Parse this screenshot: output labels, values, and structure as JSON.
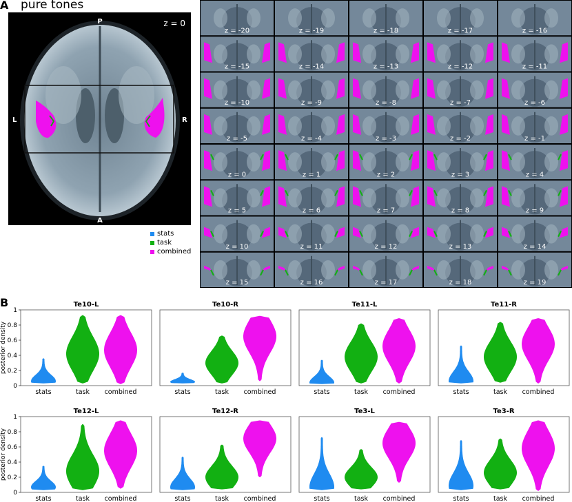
{
  "panelA": {
    "letter": "A",
    "title": "pure tones",
    "big_slice": {
      "label": "z = 0",
      "orientation": {
        "top": "P",
        "bottom": "A",
        "left": "L",
        "right": "R"
      }
    },
    "montage_labels": [
      "z = -20",
      "z = -19",
      "z = -18",
      "z = -17",
      "z = -16",
      "z = -15",
      "z = -14",
      "z = -13",
      "z = -12",
      "z = -11",
      "z = -10",
      "z = -9",
      "z = -8",
      "z = -7",
      "z = -6",
      "z = -5",
      "z = -4",
      "z = -3",
      "z = -2",
      "z = -1",
      "z = 0",
      "z = 1",
      "z = 2",
      "z = 3",
      "z = 4",
      "z = 5",
      "z = 6",
      "z = 7",
      "z = 8",
      "z = 9",
      "z = 10",
      "z = 11",
      "z = 12",
      "z = 13",
      "z = 14",
      "z = 15",
      "z = 16",
      "z = 17",
      "z = 18",
      "z = 19"
    ],
    "legend": [
      {
        "label": "stats",
        "color": "#1f8bf0"
      },
      {
        "label": "task",
        "color": "#12b012"
      },
      {
        "label": "combined",
        "color": "#ee11ee"
      }
    ]
  },
  "panelB": {
    "letter": "B",
    "ylabel": "posterior density",
    "y_ticks": [
      "0",
      "0.2",
      "0.4",
      "0.6",
      "0.8",
      "1"
    ],
    "categories": [
      "stats",
      "task",
      "combined"
    ],
    "colors": {
      "stats": "#1f8bf0",
      "task": "#12b012",
      "combined": "#ee11ee"
    }
  },
  "chart_data": [
    {
      "type": "violin",
      "title": "Te10-L",
      "categories": [
        "stats",
        "task",
        "combined"
      ],
      "ylim": [
        0,
        1
      ],
      "series": [
        {
          "name": "stats",
          "min": 0.03,
          "max": 0.36,
          "median": 0.06
        },
        {
          "name": "task",
          "min": 0.03,
          "max": 0.93,
          "median": 0.42
        },
        {
          "name": "combined",
          "min": 0.02,
          "max": 0.93,
          "median": 0.47
        }
      ]
    },
    {
      "type": "violin",
      "title": "Te10-R",
      "categories": [
        "stats",
        "task",
        "combined"
      ],
      "ylim": [
        0,
        1
      ],
      "series": [
        {
          "name": "stats",
          "min": 0.03,
          "max": 0.17,
          "median": 0.05
        },
        {
          "name": "task",
          "min": 0.03,
          "max": 0.66,
          "median": 0.3
        },
        {
          "name": "combined",
          "min": 0.06,
          "max": 0.92,
          "median": 0.65
        }
      ]
    },
    {
      "type": "violin",
      "title": "Te11-L",
      "categories": [
        "stats",
        "task",
        "combined"
      ],
      "ylim": [
        0,
        1
      ],
      "series": [
        {
          "name": "stats",
          "min": 0.02,
          "max": 0.34,
          "median": 0.04
        },
        {
          "name": "task",
          "min": 0.03,
          "max": 0.82,
          "median": 0.38
        },
        {
          "name": "combined",
          "min": 0.03,
          "max": 0.89,
          "median": 0.52
        }
      ]
    },
    {
      "type": "violin",
      "title": "Te11-R",
      "categories": [
        "stats",
        "task",
        "combined"
      ],
      "ylim": [
        0,
        1
      ],
      "series": [
        {
          "name": "stats",
          "min": 0.03,
          "max": 0.53,
          "median": 0.06
        },
        {
          "name": "task",
          "min": 0.04,
          "max": 0.84,
          "median": 0.38
        },
        {
          "name": "combined",
          "min": 0.03,
          "max": 0.89,
          "median": 0.55
        }
      ]
    },
    {
      "type": "violin",
      "title": "Te12-L",
      "categories": [
        "stats",
        "task",
        "combined"
      ],
      "ylim": [
        0,
        1
      ],
      "series": [
        {
          "name": "stats",
          "min": 0.03,
          "max": 0.35,
          "median": 0.07
        },
        {
          "name": "task",
          "min": 0.03,
          "max": 0.9,
          "median": 0.28
        },
        {
          "name": "combined",
          "min": 0.05,
          "max": 0.95,
          "median": 0.55
        }
      ]
    },
    {
      "type": "violin",
      "title": "Te12-R",
      "categories": [
        "stats",
        "task",
        "combined"
      ],
      "ylim": [
        0,
        1
      ],
      "series": [
        {
          "name": "stats",
          "min": 0.03,
          "max": 0.47,
          "median": 0.07
        },
        {
          "name": "task",
          "min": 0.04,
          "max": 0.63,
          "median": 0.2
        },
        {
          "name": "combined",
          "min": 0.2,
          "max": 0.95,
          "median": 0.71
        }
      ]
    },
    {
      "type": "violin",
      "title": "Te3-L",
      "categories": [
        "stats",
        "task",
        "combined"
      ],
      "ylim": [
        0,
        1
      ],
      "series": [
        {
          "name": "stats",
          "min": 0.03,
          "max": 0.73,
          "median": 0.07
        },
        {
          "name": "task",
          "min": 0.04,
          "max": 0.57,
          "median": 0.2
        },
        {
          "name": "combined",
          "min": 0.13,
          "max": 0.93,
          "median": 0.65
        }
      ]
    },
    {
      "type": "violin",
      "title": "Te3-R",
      "categories": [
        "stats",
        "task",
        "combined"
      ],
      "ylim": [
        0,
        1
      ],
      "series": [
        {
          "name": "stats",
          "min": 0.03,
          "max": 0.69,
          "median": 0.09
        },
        {
          "name": "task",
          "min": 0.04,
          "max": 0.71,
          "median": 0.26
        },
        {
          "name": "combined",
          "min": 0.02,
          "max": 0.95,
          "median": 0.58
        }
      ]
    }
  ]
}
